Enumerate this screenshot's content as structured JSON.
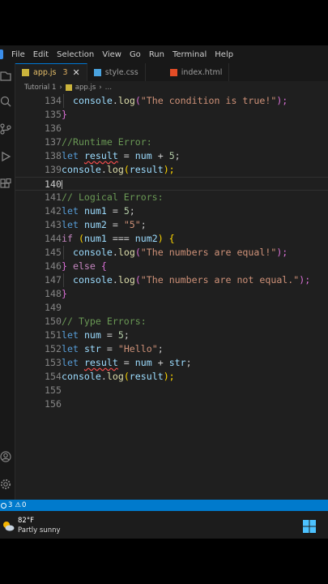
{
  "menu": [
    "File",
    "Edit",
    "Selection",
    "View",
    "Go",
    "Run",
    "Terminal",
    "Help"
  ],
  "tabs": [
    {
      "label": "app.js",
      "badge": "3",
      "close": "✕"
    },
    {
      "label": "style.css"
    },
    {
      "label": "index.html"
    }
  ],
  "breadcrumb": {
    "folder": "Tutorial 1",
    "sep": "›",
    "file": "app.js",
    "rest": "…"
  },
  "lines": [
    "134",
    "135",
    "136",
    "137",
    "138",
    "139",
    "140",
    "141",
    "142",
    "143",
    "144",
    "145",
    "146",
    "147",
    "148",
    "149",
    "150",
    "151",
    "152",
    "153",
    "154",
    "155",
    "156"
  ],
  "code": {
    "l134": [
      "console",
      ".",
      "log",
      "(",
      "\"The condition is true!\"",
      ");"
    ],
    "l135": "}",
    "l137": "//Runtime Error:",
    "l138": [
      "let",
      " ",
      "result",
      " = ",
      "num",
      " + ",
      "5",
      ";"
    ],
    "l139": [
      "console",
      ".",
      "log",
      "(",
      "result",
      ");"
    ],
    "l141": "// Logical Errors:",
    "l142": [
      "let",
      " ",
      "num1",
      " = ",
      "5",
      ";"
    ],
    "l143": [
      "let",
      " ",
      "num2",
      " = ",
      "\"5\"",
      ";"
    ],
    "l144": [
      "if",
      " (",
      "num1",
      " === ",
      "num2",
      ") {"
    ],
    "l145": [
      "console",
      ".",
      "log",
      "(",
      "\"The numbers are equal!\"",
      ");"
    ],
    "l146": [
      "} ",
      "else",
      " {"
    ],
    "l147": [
      "console",
      ".",
      "log",
      "(",
      "\"The numbers are not equal.\"",
      ");"
    ],
    "l148": "}",
    "l150": "// Type Errors:",
    "l151": [
      "let",
      " ",
      "num",
      " = ",
      "5",
      ";"
    ],
    "l152": [
      "let",
      " ",
      "str",
      " = ",
      "\"Hello\"",
      ";"
    ],
    "l153": [
      "let",
      " ",
      "result",
      " = ",
      "num",
      " + ",
      "str",
      ";"
    ],
    "l154": [
      "console",
      ".",
      "log",
      "(",
      "result",
      ");"
    ]
  },
  "status": {
    "errors": "3",
    "warnings": "0"
  },
  "weather": {
    "temp": "82°F",
    "condition": "Partly sunny"
  },
  "colors": {
    "accent": "#007acc",
    "editor_bg": "#1f1f1f"
  }
}
